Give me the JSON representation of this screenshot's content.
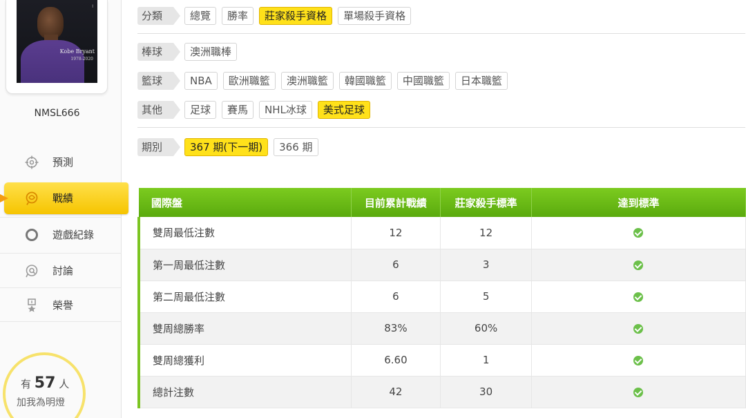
{
  "sidebar": {
    "avatar": {
      "caption_name": "Kobe Bryant",
      "caption_years": "1978-2020"
    },
    "username": "NMSL666",
    "nav": [
      {
        "label": "預測",
        "icon": "crosshair-icon"
      },
      {
        "label": "戰績",
        "icon": "medal-icon",
        "active": true
      },
      {
        "label": "遊戲紀錄",
        "icon": "circle-icon"
      },
      {
        "label": "討論",
        "icon": "magnifier-chat-icon"
      },
      {
        "label": "榮譽",
        "icon": "award-ribbon-icon"
      }
    ],
    "fans": {
      "prefix": "有",
      "count": "57",
      "suffix": "人",
      "line2": "加我為明燈"
    }
  },
  "filters": {
    "category": {
      "label": "分類",
      "options": [
        "總覽",
        "勝率",
        "莊家殺手資格",
        "單場殺手資格"
      ],
      "selected": "莊家殺手資格"
    },
    "baseball": {
      "label": "棒球",
      "options": [
        "澳洲職棒"
      ]
    },
    "basketball": {
      "label": "籃球",
      "options": [
        "NBA",
        "歐洲職籃",
        "澳洲職籃",
        "韓國職籃",
        "中國職籃",
        "日本職籃"
      ]
    },
    "other": {
      "label": "其他",
      "options": [
        "足球",
        "賽馬",
        "NHL冰球",
        "美式足球"
      ],
      "selected": "美式足球"
    },
    "period": {
      "label": "期別",
      "options": [
        "367 期(下一期)",
        "366 期"
      ],
      "selected": "367 期(下一期)"
    }
  },
  "table": {
    "headers": [
      "國際盤",
      "目前累計戰績",
      "莊家殺手標準",
      "達到標準"
    ],
    "rows": [
      {
        "name": "雙周最低注數",
        "current": "12",
        "standard": "12",
        "met": true
      },
      {
        "name": "第一周最低注數",
        "current": "6",
        "standard": "3",
        "met": true
      },
      {
        "name": "第二周最低注數",
        "current": "6",
        "standard": "5",
        "met": true
      },
      {
        "name": "雙周總勝率",
        "current": "83%",
        "standard": "60%",
        "met": true
      },
      {
        "name": "雙周總獲利",
        "current": "6.60",
        "standard": "1",
        "met": true
      },
      {
        "name": "總計注數",
        "current": "42",
        "standard": "30",
        "met": true
      }
    ]
  },
  "colors": {
    "accent_yellow": "#ffe11a",
    "table_green": "#6bbd17",
    "check_green": "#6cc04a"
  }
}
